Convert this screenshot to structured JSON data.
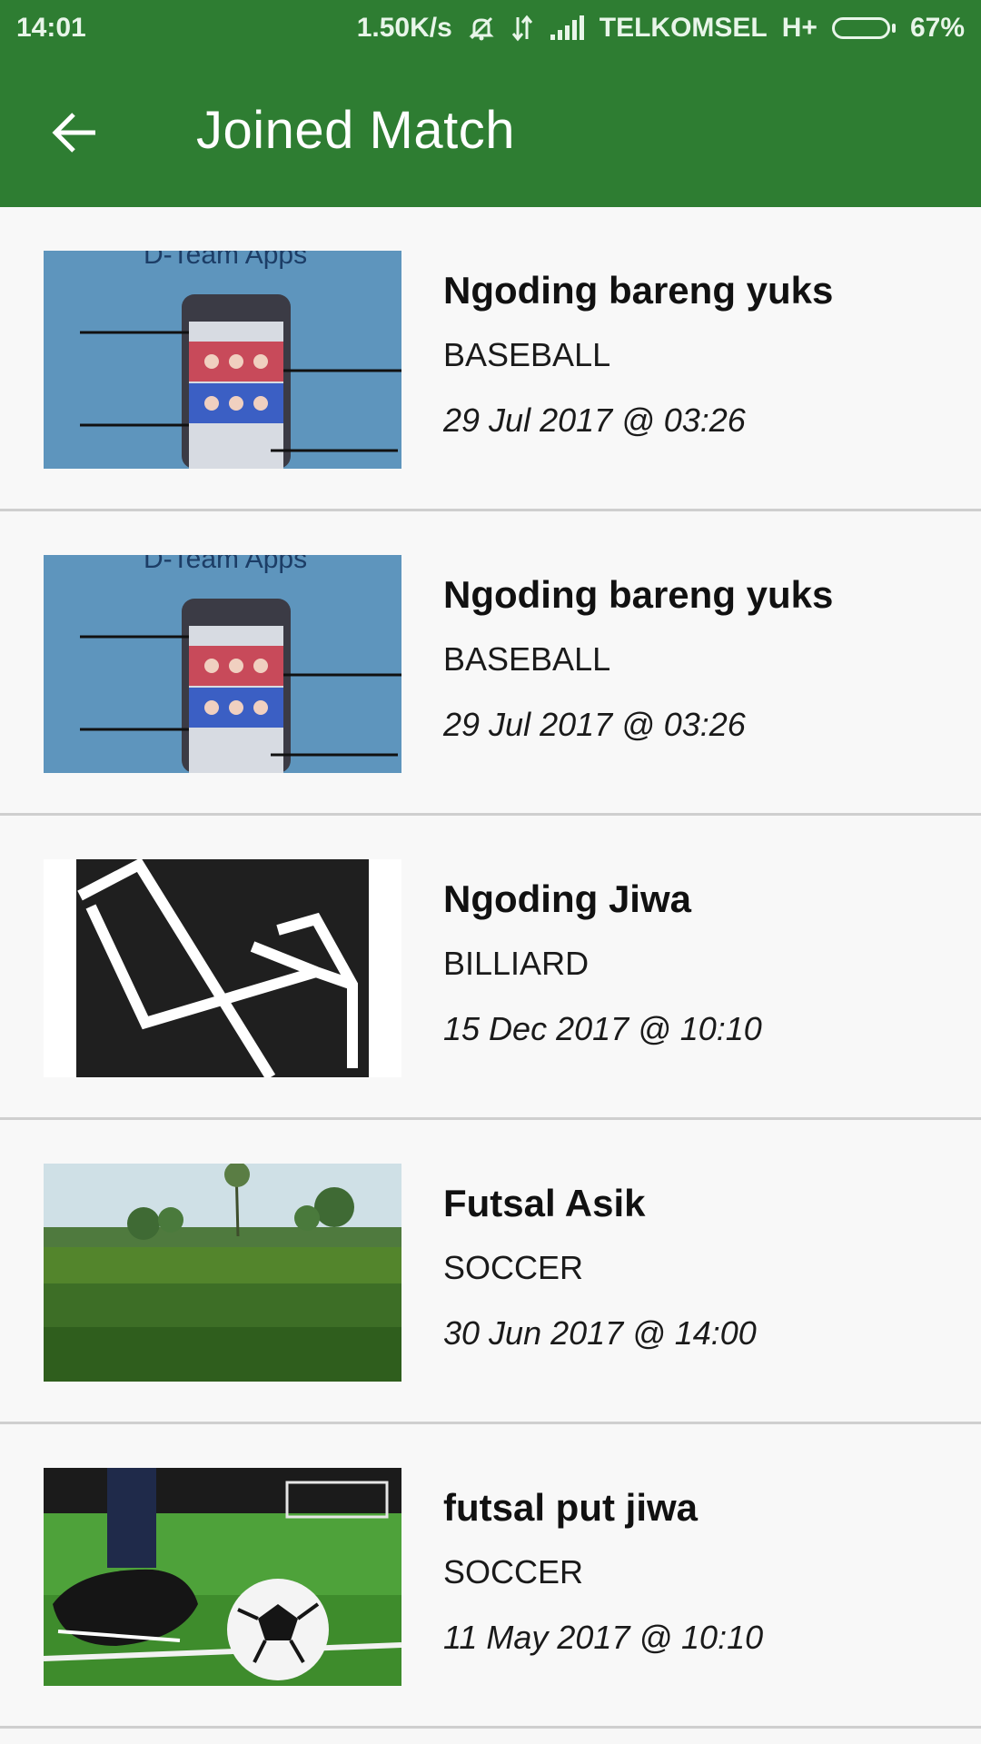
{
  "status_bar": {
    "time": "14:01",
    "speed": "1.50K/s",
    "carrier": "TELKOMSEL",
    "network": "H+",
    "battery": "67%",
    "battery_level": 0.67,
    "icons": [
      "mute-icon",
      "data-transfer-icon",
      "signal-icon",
      "battery-icon"
    ]
  },
  "app_bar": {
    "title": "Joined Match",
    "back_icon": "arrow-back-icon",
    "color": "#2e7d32"
  },
  "matches": [
    {
      "name": "Ngoding bareng yuks",
      "sport": "BASEBALL",
      "datetime": "29 Jul 2017 @ 03:26",
      "thumbnail": "dteam-apps-photo"
    },
    {
      "name": "Ngoding bareng yuks",
      "sport": "BASEBALL",
      "datetime": "29 Jul 2017 @ 03:26",
      "thumbnail": "dteam-apps-photo"
    },
    {
      "name": "Ngoding Jiwa",
      "sport": "BILLIARD",
      "datetime": "15 Dec 2017 @ 10:10",
      "thumbnail": "laravel-logo"
    },
    {
      "name": "Futsal Asik",
      "sport": "SOCCER",
      "datetime": "30 Jun 2017 @ 14:00",
      "thumbnail": "grass-field-photo"
    },
    {
      "name": "futsal put jiwa",
      "sport": "SOCCER",
      "datetime": "11 May 2017 @ 10:10",
      "thumbnail": "soccer-ball-photo"
    }
  ]
}
